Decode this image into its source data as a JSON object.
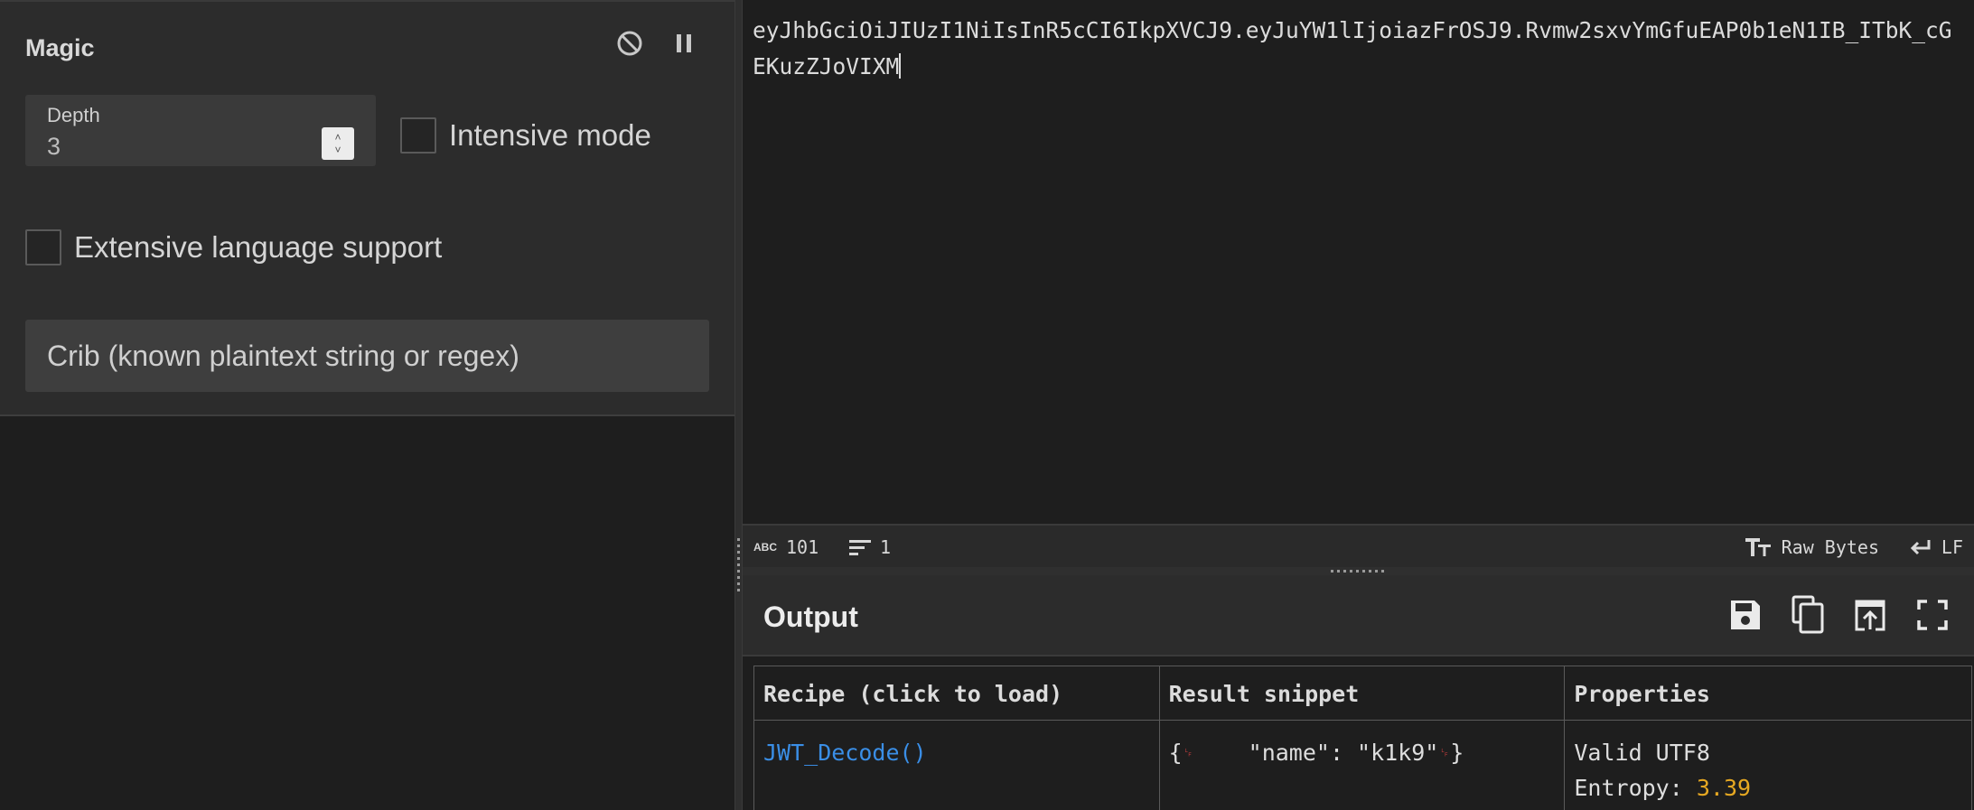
{
  "magic": {
    "title": "Magic",
    "depth_label": "Depth",
    "depth_value": "3",
    "intensive_label": "Intensive mode",
    "extensive_label": "Extensive language support",
    "crib_placeholder": "Crib (known plaintext string or regex)"
  },
  "input": {
    "text": "eyJhbGciOiJIUzI1NiIsInR5cCI6IkpXVCJ9.eyJuYW1lIjoiazFrOSJ9.Rvmw2sxvYmGfuEAP0b1eN1IB_ITbK_cGEKuzZJoVIXM",
    "char_count": "101",
    "line_count": "1",
    "encoding_label": "Raw Bytes",
    "eol_label": "LF"
  },
  "output": {
    "title": "Output",
    "table": {
      "headers": [
        "Recipe (click to load)",
        "Result snippet",
        "Properties"
      ],
      "rows": [
        {
          "recipe": "JWT_Decode()",
          "snippet_open": "{",
          "snippet_body": "    \"name\": \"k1k9\"",
          "snippet_close": "}",
          "prop_line1": "Valid UTF8",
          "prop_entropy_label": "Entropy: ",
          "prop_entropy_value": "3.39"
        }
      ]
    }
  },
  "colors": {
    "link": "#3a8ee6",
    "entropy": "#e6a822",
    "newline_marker": "#d04040"
  },
  "icons": [
    "disable-icon",
    "pause-icon",
    "abc-icon",
    "lines-icon",
    "text-size-icon",
    "return-icon",
    "save-icon",
    "copy-icon",
    "replace-input-icon",
    "fullscreen-icon"
  ]
}
